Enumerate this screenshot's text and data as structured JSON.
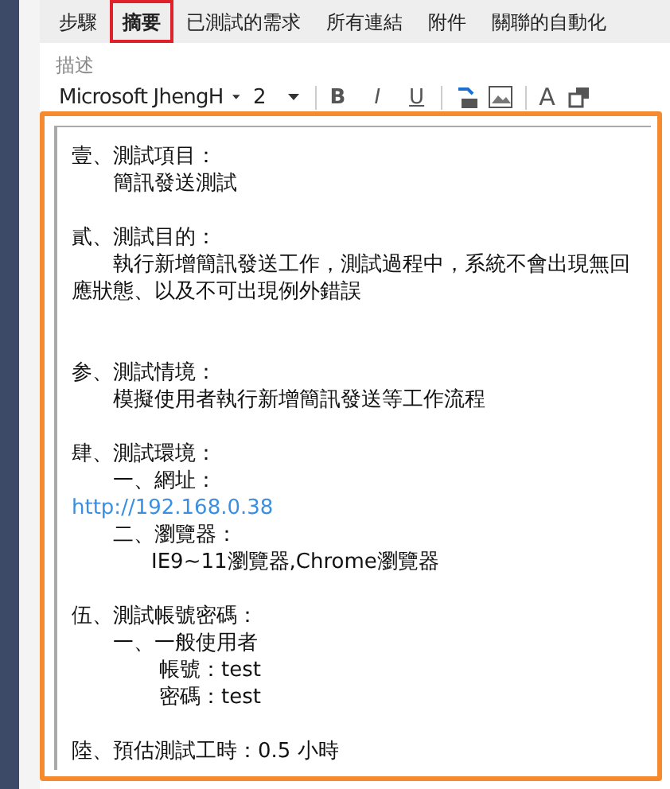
{
  "tabs": [
    {
      "label": "步驟",
      "selected": false
    },
    {
      "label": "摘要",
      "selected": true
    },
    {
      "label": "已測試的需求",
      "selected": false
    },
    {
      "label": "所有連結",
      "selected": false
    },
    {
      "label": "附件",
      "selected": false
    },
    {
      "label": "關聯的自動化",
      "selected": false
    }
  ],
  "field_label": "描述",
  "toolbar": {
    "font": "Microsoft JhengH",
    "size": "2",
    "bold": "B",
    "italic": "I",
    "underline": "U",
    "font_color": "A"
  },
  "editor": {
    "focused": true,
    "lines": [
      {
        "kind": "heading",
        "text": "壹、測試項目："
      },
      {
        "kind": "item",
        "text": "簡訊發送測試"
      },
      {
        "kind": "blank"
      },
      {
        "kind": "heading",
        "text": "貳、測試目的："
      },
      {
        "kind": "item",
        "text": "執行新增簡訊發送工作，測試過程中，系統不會出現無回應狀態、以及不可出現例外錯誤"
      },
      {
        "kind": "blank"
      },
      {
        "kind": "blank"
      },
      {
        "kind": "heading",
        "text": "参、測試情境："
      },
      {
        "kind": "item",
        "text": "模擬使用者執行新增簡訊發送等工作流程"
      },
      {
        "kind": "blank"
      },
      {
        "kind": "heading",
        "text": "肆、測試環境："
      },
      {
        "kind": "item",
        "text": "一、網址："
      },
      {
        "kind": "link",
        "text": "http://192.168.0.38"
      },
      {
        "kind": "item",
        "text": "二、瀏覽器："
      },
      {
        "kind": "subitem",
        "text": "IE9~11瀏覽器,Chrome瀏覽器"
      },
      {
        "kind": "blank"
      },
      {
        "kind": "heading",
        "text": "伍、測試帳號密碼："
      },
      {
        "kind": "item",
        "text": "一、一般使用者"
      },
      {
        "kind": "subitem2",
        "text": "帳號：test"
      },
      {
        "kind": "subitem2",
        "text": "密碼：test"
      },
      {
        "kind": "blank"
      },
      {
        "kind": "heading",
        "text": "陸、預估測試工時：0.5 小時"
      }
    ]
  }
}
